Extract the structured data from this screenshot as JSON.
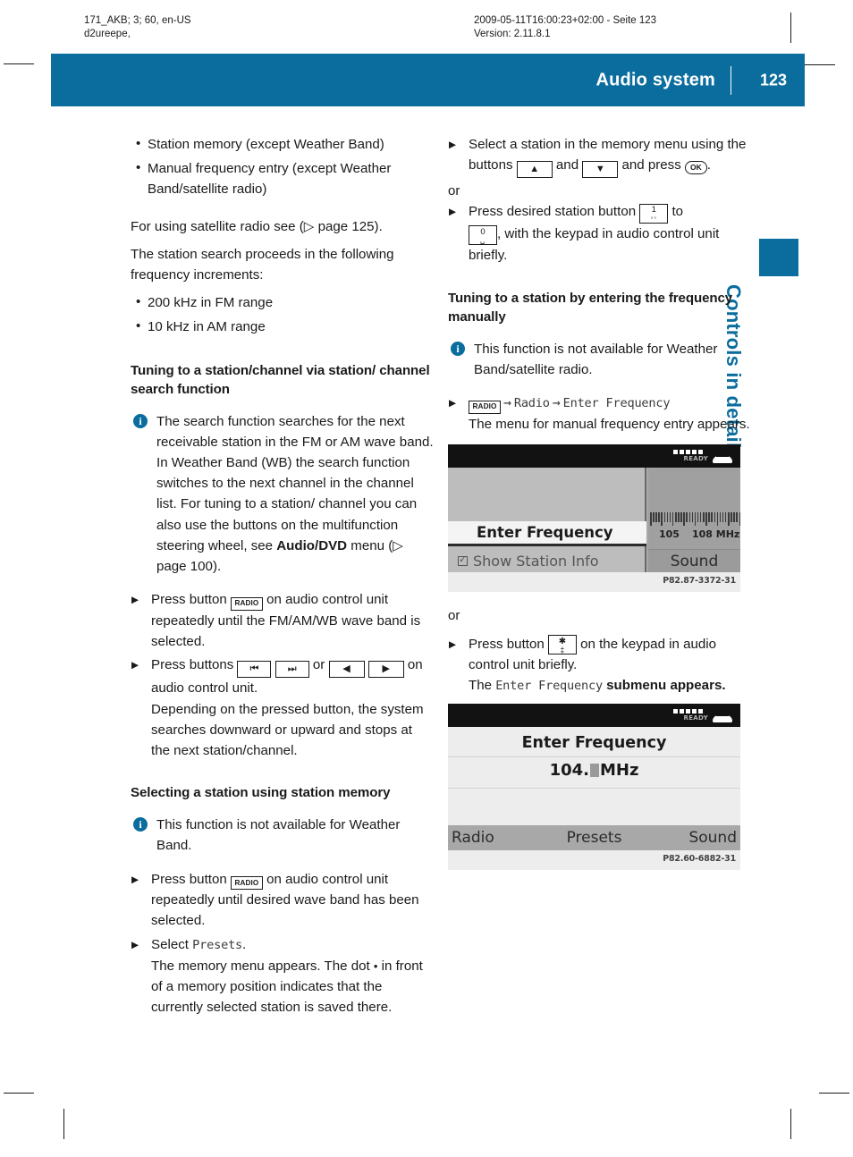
{
  "print_header": {
    "left_line1": "171_AKB; 3; 60, en-US",
    "left_line2": "d2ureepe,",
    "mid_line1": "2009-05-11T16:00:23+02:00 - Seite 123",
    "mid_line2": "Version: 2.11.8.1"
  },
  "header": {
    "title": "Audio system",
    "page_number": "123",
    "accent_color": "#0a6d9e"
  },
  "side_tab": {
    "label": "Controls in detail"
  },
  "left_column": {
    "bullets_top": [
      "Station memory (except Weather Band)",
      "Manual frequency entry (except Weather Band/satellite radio)"
    ],
    "para_satellite": "For using satellite radio see (▷ page 125).",
    "para_increments": "The station search proceeds in the following frequency increments:",
    "bullets_increments": [
      "200 kHz in FM range",
      "10 kHz in AM range"
    ],
    "heading_search": "Tuning to a station/channel via station/ channel search function",
    "note_search_a": "The search function searches for the next receivable station in the FM or AM wave band. In Weather Band (WB) the search function switches to the next channel in the channel list. For tuning to a station/ channel you can also use the buttons on the multifunction steering wheel, see ",
    "note_search_bold": "Audio/DVD",
    "note_search_b": " menu (▷ page 100).",
    "step1_pre": "Press button ",
    "step1_post": " on audio control unit repeatedly until the FM/AM/WB wave band is selected.",
    "step2_pre": "Press buttons ",
    "step2_or": " or ",
    "step2_post": " on audio control unit.",
    "step2_cont": "Depending on the pressed button, the system searches downward or upward and stops at the next station/channel.",
    "heading_memory": "Selecting a station using station memory",
    "note_memory": "This function is not available for Weather Band.",
    "step3_pre": "Press button ",
    "step3_post": " on audio control unit repeatedly until desired wave band has been selected.",
    "step4_pre": "Select ",
    "step4_ui": "Presets",
    "step4_post": ".",
    "step4_cont_a": "The memory menu appears. The dot ",
    "step4_cont_dot": "•",
    "step4_cont_b": " in front of a memory position indicates that the currently selected station is saved there."
  },
  "right_column": {
    "step1_pre": "Select a station in the memory menu using the buttons ",
    "step1_and": " and ",
    "step1_press": " and press ",
    "step1_ok": "OK",
    "step1_end": ".",
    "or_1": "or",
    "step2_pre": "Press desired station button ",
    "step2_to": " to",
    "step2_post": ", with the keypad in audio control unit briefly.",
    "heading_manual": "Tuning to a station by entering the frequency manually",
    "note_manual": "This function is not available for Weather Band/satellite radio.",
    "menu_path": {
      "button": "RADIO",
      "item1": "Radio",
      "item2": "Enter Frequency",
      "arrow": "→"
    },
    "menu_path_cont": "The menu for manual frequency entry appears.",
    "or_2": "or",
    "step3_pre": "Press button ",
    "step3_post": " on the keypad in audio control unit briefly.",
    "step3_cont_a": "The ",
    "step3_cont_ui": "Enter Frequency",
    "step3_cont_b": " submenu appears."
  },
  "keys": {
    "radio": "RADIO",
    "skip_back": "⏮",
    "skip_fwd": "⏭",
    "left_tri": "◀",
    "right_tri": "▶",
    "up_tri": "▲",
    "down_tri": "▼",
    "num_one": "1",
    "num_one_sub": "◦◦",
    "num_zero": "0",
    "num_zero_sub": "␣",
    "star": "✱",
    "star_sub": "‡"
  },
  "screenshot_1": {
    "status_ready": "READY",
    "selected_item": "Enter Frequency",
    "option_item": "Show Station Info",
    "scale_label_left": "105",
    "scale_label_right": "108 MHz",
    "sound_button": "Sound",
    "caption": "P82.87-3372-31"
  },
  "screenshot_2": {
    "status_ready": "READY",
    "title": "Enter Frequency",
    "frequency_prefix": "104.",
    "frequency_unit": "MHz",
    "bottom_left": "Radio",
    "bottom_center": "Presets",
    "bottom_right": "Sound",
    "caption": "P82.60-6882-31"
  }
}
